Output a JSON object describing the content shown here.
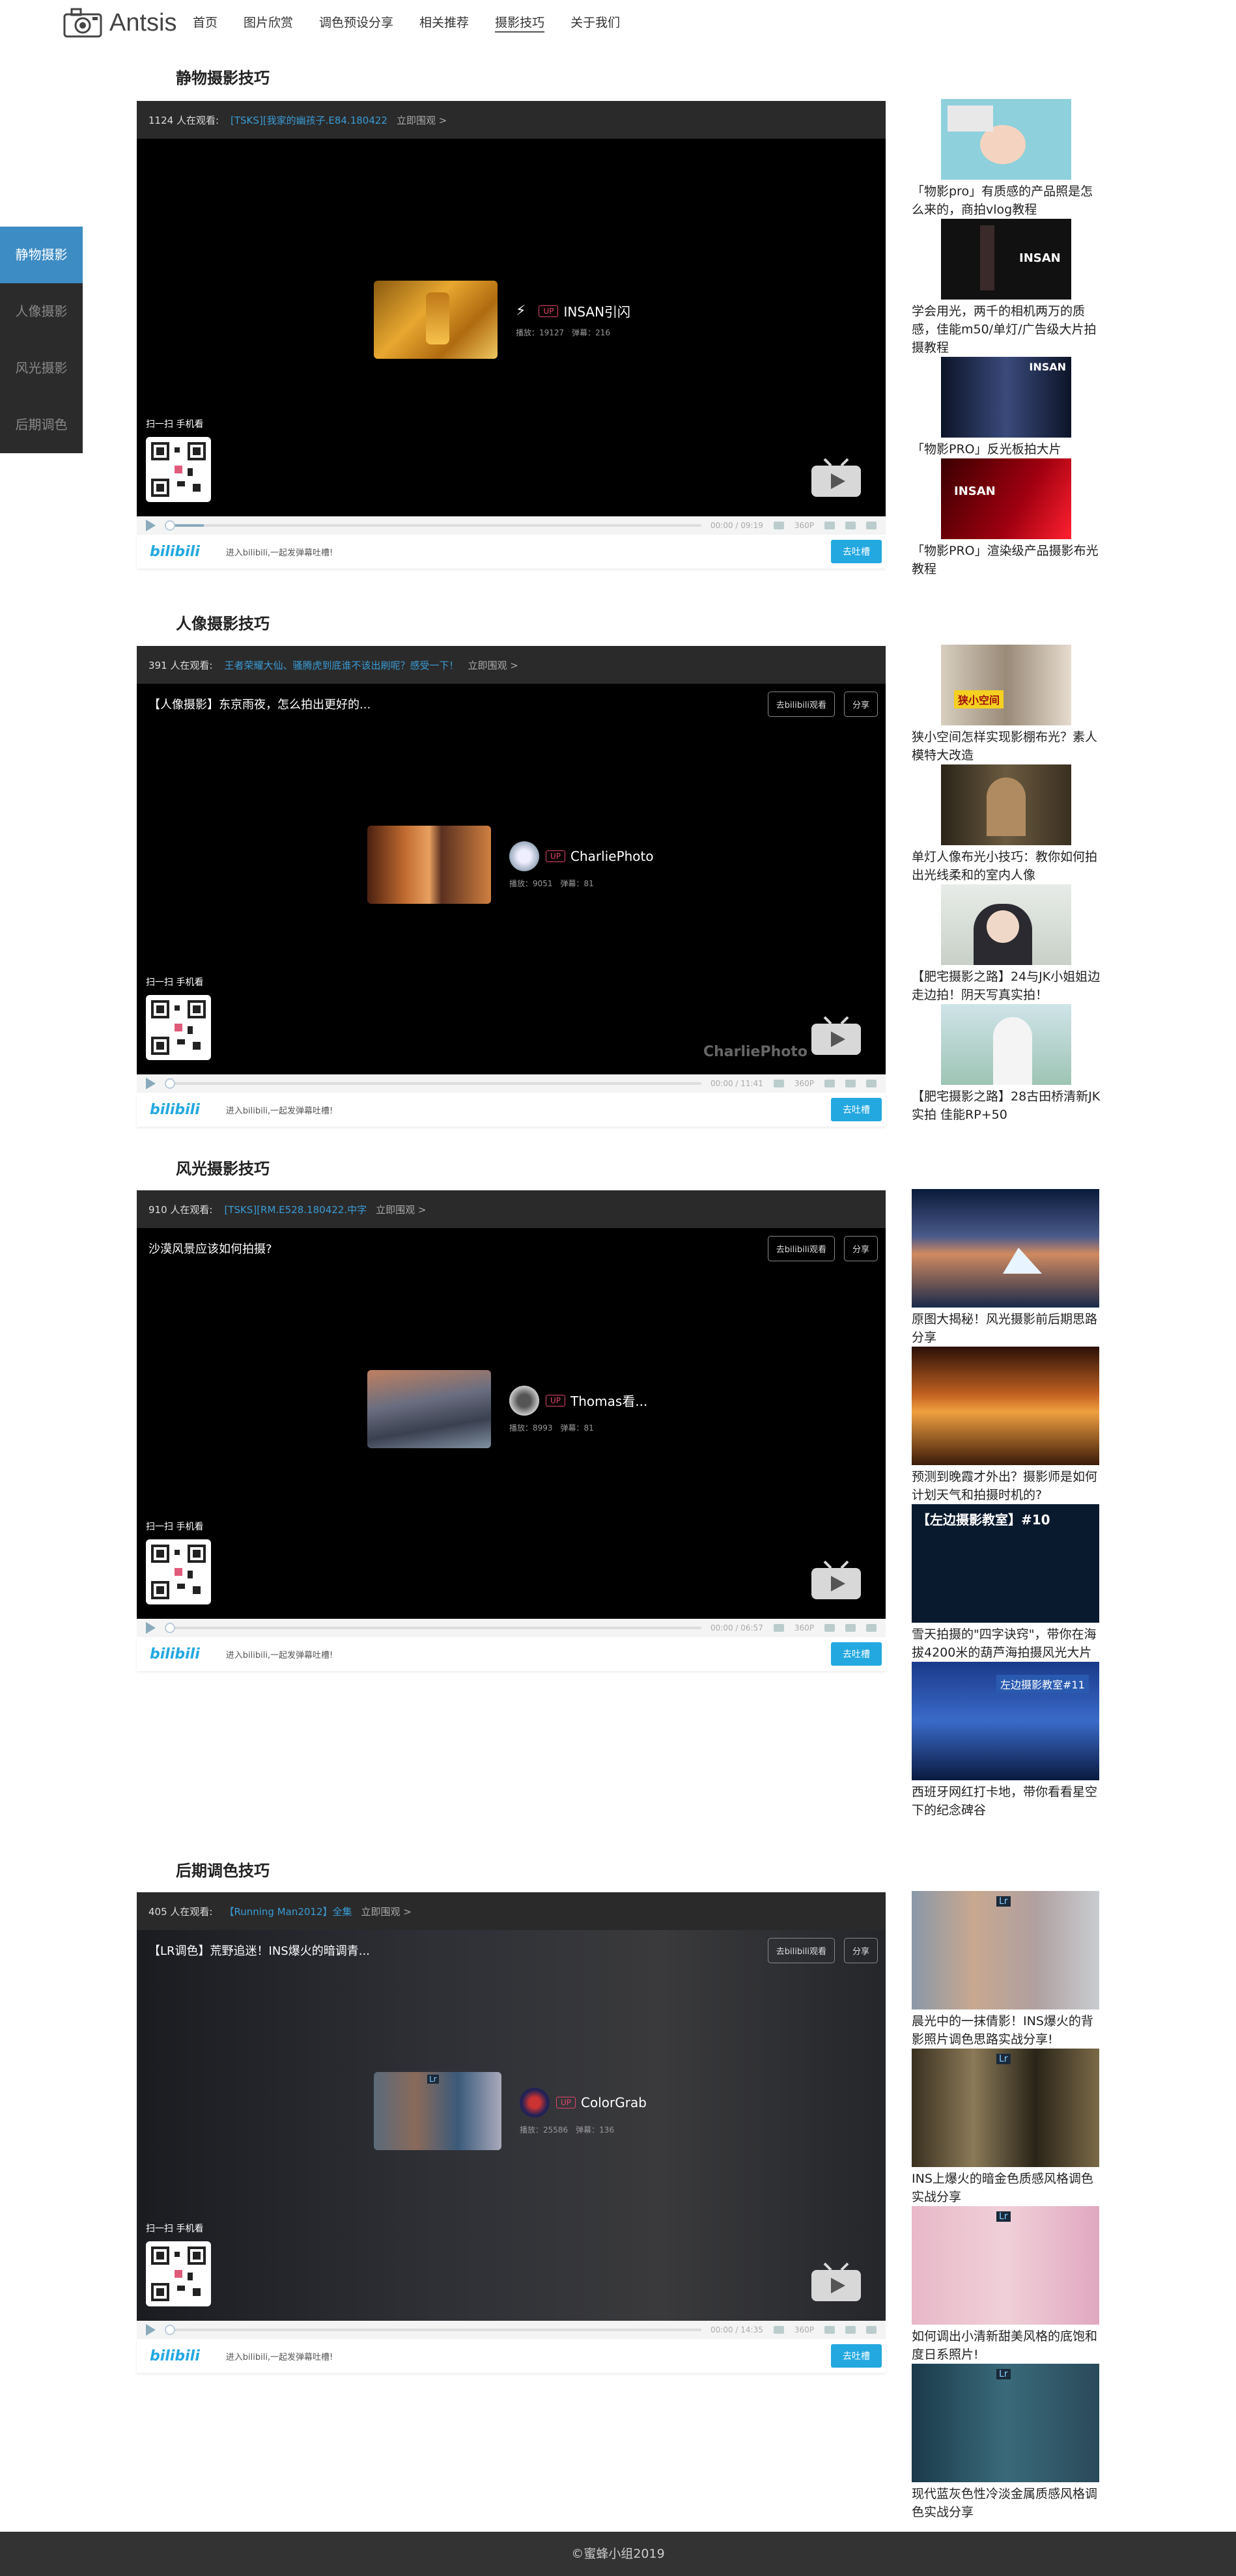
{
  "brand": {
    "name": "Antsis"
  },
  "nav": [
    "首页",
    "图片欣赏",
    "调色预设分享",
    "相关推荐",
    "摄影技巧",
    "关于我们"
  ],
  "side": [
    "静物摄影",
    "人像摄影",
    "风光摄影",
    "后期调色"
  ],
  "player_ui": {
    "qr_label": "扫一扫 手机看",
    "danmaku_placeholder": "进入bilibili,一起发弹幕吐槽!",
    "send_label": "去吐槽",
    "go_bili": "去bilibili观看",
    "share": "分享",
    "quality": "360P",
    "bili_logo": "bilibili",
    "up_badge": "UP",
    "more": "立即围观 >"
  },
  "sections": [
    {
      "title": "静物摄影技巧",
      "watching": "1124 人在观看:",
      "video_title": "[TSKS][我家的幽孩子.E84.180422",
      "caption": "",
      "up_name": "INSAN引闪",
      "stats": "播放：19127　弹幕：216",
      "time": "00:00 / 09:19",
      "watermark": "",
      "related": [
        {
          "title": "「物影pro」有质感的产品照是怎么来的，商拍vlog教程"
        },
        {
          "title": "学会用光，两千的相机两万的质感，佳能m50/单灯/广告级大片拍摄教程"
        },
        {
          "title": "「物影PRO」反光板拍大片"
        },
        {
          "title": "「物影PRO」渲染级产品摄影布光教程"
        }
      ]
    },
    {
      "title": "人像摄影技巧",
      "watching": "391 人在观看:",
      "video_title": "王者荣耀大仙、骚腾虎到底谁不该出刷呢？感受一下！",
      "caption": "【人像摄影】东京雨夜，怎么拍出更好的...",
      "up_name": "CharliePhoto",
      "stats": "播放：9051　弹幕：81",
      "time": "00:00 / 11:41",
      "watermark": "CharliePhoto",
      "related": [
        {
          "title": "狭小空间怎样实现影棚布光？素人模特大改造"
        },
        {
          "title": "单灯人像布光小技巧：教你如何拍出光线柔和的室内人像"
        },
        {
          "title": "【肥宅摄影之路】24与JK小姐姐边走边拍！阴天写真实拍！"
        },
        {
          "title": "【肥宅摄影之路】28古田桥清新JK实拍 佳能RP+50"
        }
      ]
    },
    {
      "title": "风光摄影技巧",
      "watching": "910 人在观看:",
      "video_title": "[TSKS][RM.E528.180422.中字",
      "caption": "沙漠风景应该如何拍摄?",
      "up_name": "Thomas看...",
      "stats": "播放：8993　弹幕：81",
      "time": "00:00 / 06:57",
      "watermark": "",
      "related": [
        {
          "title": "原图大揭秘！风光摄影前后期思路分享"
        },
        {
          "title": "预测到晚霞才外出？摄影师是如何计划天气和拍摄时机的?"
        },
        {
          "title": "雪天拍摄的\"四字诀窍\"，带你在海拔4200米的葫芦海拍摄风光大片",
          "thumb_text": "【左边摄影教室】#10"
        },
        {
          "title": "西班牙网红打卡地，带你看看星空下的纪念碑谷",
          "thumb_text": "左边摄影教室#11"
        }
      ]
    },
    {
      "title": "后期调色技巧",
      "watching": "405 人在观看:",
      "video_title": "【Running Man2012】全集",
      "caption": "【LR调色】荒野追迷！INS爆火的暗调青...",
      "up_name": "ColorGrab",
      "stats": "播放：25586　弹幕：136",
      "time": "00:00 / 14:35",
      "watermark": "",
      "related": [
        {
          "title": "晨光中的一抹倩影！INS爆火的背影照片调色思路实战分享!"
        },
        {
          "title": "INS上爆火的暗金色质感风格调色实战分享"
        },
        {
          "title": "如何调出小清新甜美风格的底饱和度日系照片!"
        },
        {
          "title": "现代蓝灰色性冷淡金属质感风格调色实战分享"
        }
      ]
    }
  ],
  "footer": "©蜜蜂小组2019"
}
